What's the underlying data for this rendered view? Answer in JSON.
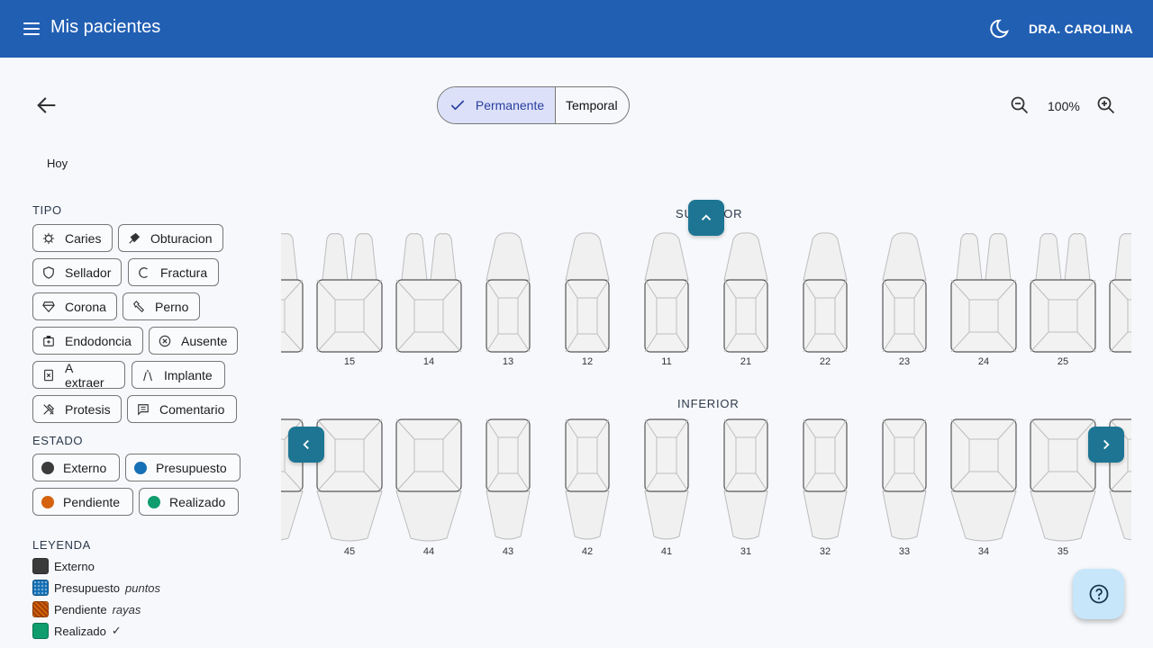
{
  "header": {
    "title": "Mis pacientes",
    "user": "DRA. CAROLINA"
  },
  "toolbar": {
    "dentition_options": [
      {
        "label": "Permanente",
        "selected": true
      },
      {
        "label": "Temporal",
        "selected": false
      }
    ],
    "zoom": "100%"
  },
  "date_label": "Hoy",
  "tipo": {
    "title": "TIPO",
    "items": [
      "Caries",
      "Obturacion",
      "Sellador",
      "Fractura",
      "Corona",
      "Perno",
      "Endodoncia",
      "Ausente",
      "A extraer",
      "Implante",
      "Protesis",
      "Comentario"
    ]
  },
  "estado": {
    "title": "ESTADO",
    "items": [
      {
        "label": "Externo",
        "color": "#3b3b3b"
      },
      {
        "label": "Presupuesto",
        "color": "#1670b5"
      },
      {
        "label": "Pendiente",
        "color": "#d4620e"
      },
      {
        "label": "Realizado",
        "color": "#0f9d6e"
      }
    ]
  },
  "leyenda": {
    "title": "LEYENDA",
    "items": [
      {
        "label": "Externo",
        "hint": ""
      },
      {
        "label": "Presupuesto",
        "hint": "puntos"
      },
      {
        "label": "Pendiente",
        "hint": "rayas"
      },
      {
        "label": "Realizado",
        "hint": "✓"
      }
    ]
  },
  "odontogram": {
    "upper_label": "SUPERIOR",
    "lower_label": "INFERIOR",
    "upper_teeth": [
      "15",
      "14",
      "13",
      "12",
      "11",
      "21",
      "22",
      "23",
      "24",
      "25"
    ],
    "lower_teeth": [
      "45",
      "44",
      "43",
      "42",
      "41",
      "31",
      "32",
      "33",
      "34",
      "35"
    ],
    "tooth_kinds": [
      "premolar",
      "premolar",
      "anterior",
      "anterior",
      "anterior",
      "anterior",
      "anterior",
      "anterior",
      "premolar",
      "premolar"
    ]
  },
  "colors": {
    "brand": "#215fb3",
    "nav_button": "#1d7593",
    "fab": "#c7e6fa"
  }
}
